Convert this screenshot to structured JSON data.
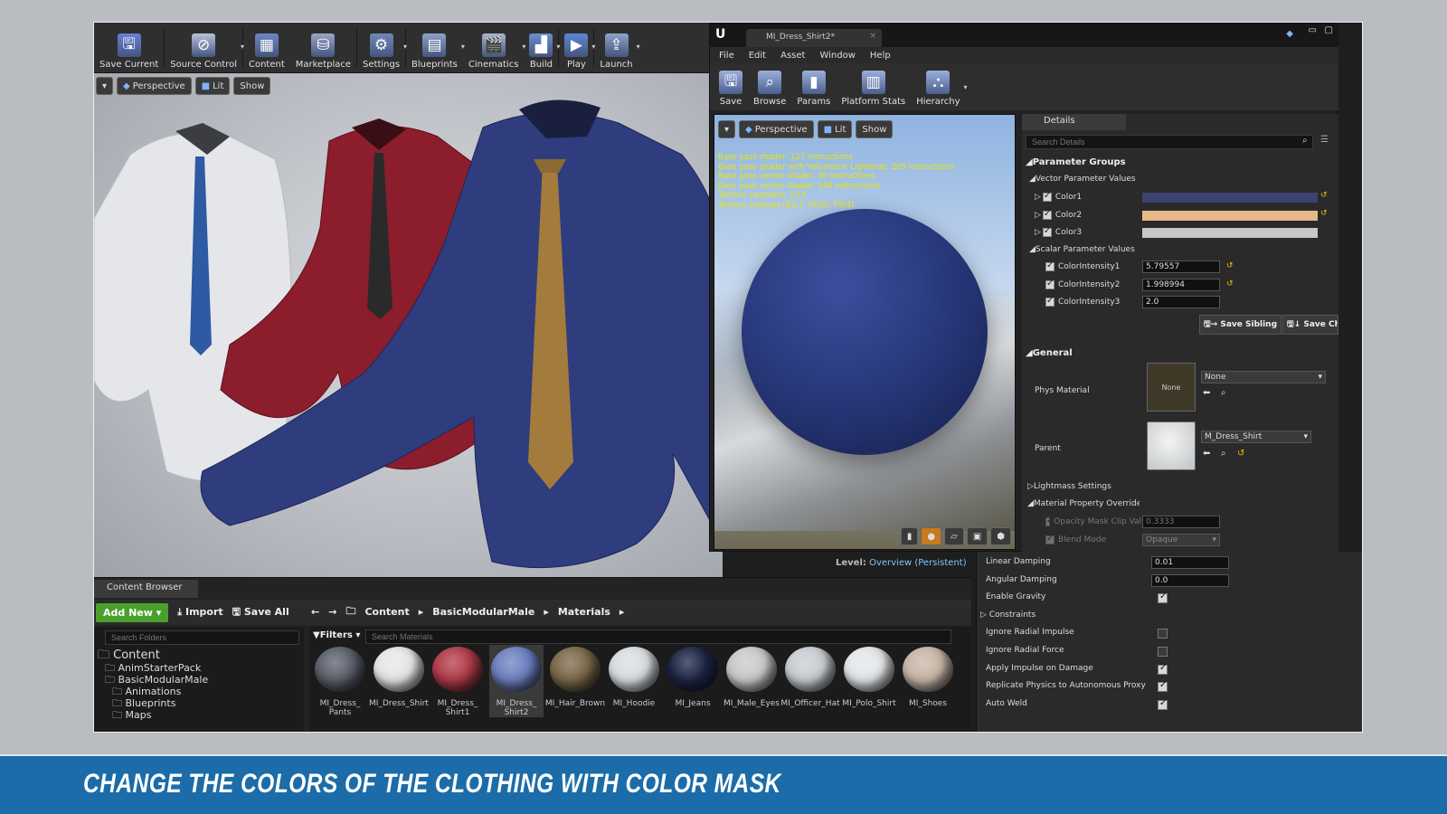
{
  "banner": {
    "text": "CHANGE THE COLORS OF THE CLOTHING WITH COLOR MASK"
  },
  "editor": {
    "toolbar": [
      {
        "label": "Save Current",
        "icon": "save-icon",
        "color": "#6a7fd8"
      },
      {
        "label": "Source Control",
        "icon": "source-control-icon",
        "color": "#b8c2d8"
      },
      {
        "label": "Content",
        "icon": "content-icon",
        "color": "#6f86c4"
      },
      {
        "label": "Marketplace",
        "icon": "marketplace-icon",
        "color": "#9aa6c6"
      },
      {
        "label": "Settings",
        "icon": "gear-icon",
        "color": "#7088b8"
      },
      {
        "label": "Blueprints",
        "icon": "blueprints-icon",
        "color": "#8fa0c8"
      },
      {
        "label": "Cinematics",
        "icon": "cinematics-icon",
        "color": "#a8b4cc"
      },
      {
        "label": "Build",
        "icon": "build-icon",
        "color": "#6a8fd0"
      },
      {
        "label": "Play",
        "icon": "play-icon",
        "color": "#5d86d6"
      },
      {
        "label": "Launch",
        "icon": "launch-icon",
        "color": "#8da2c8"
      }
    ],
    "viewport": {
      "perspective": "Perspective",
      "lit": "Lit",
      "show": "Show"
    },
    "level": {
      "label": "Level:",
      "value": "Overview (Persistent)"
    }
  },
  "content_browser": {
    "tab": "Content Browser",
    "add_new": "Add New",
    "import": "Import",
    "save_all": "Save All",
    "breadcrumbs": [
      "Content",
      "BasicModularMale",
      "Materials"
    ],
    "search_folders_placeholder": "Search Folders",
    "filters": "Filters",
    "search_materials_placeholder": "Search Materials",
    "tree": [
      {
        "label": "Content",
        "level": 0
      },
      {
        "label": "AnimStarterPack",
        "level": 1
      },
      {
        "label": "BasicModularMale",
        "level": 1
      },
      {
        "label": "Animations",
        "level": 2
      },
      {
        "label": "Blueprints",
        "level": 2
      },
      {
        "label": "Maps",
        "level": 2
      }
    ],
    "assets": [
      {
        "label": "MI_Dress_ Pants",
        "color": "#5a5f6a"
      },
      {
        "label": "MI_Dress_Shirt",
        "color": "#e6e6e6"
      },
      {
        "label": "MI_Dress_ Shirt1",
        "color": "#b03a48"
      },
      {
        "label": "MI_Dress_ Shirt2",
        "color": "#6a7fbf"
      },
      {
        "label": "MI_Hair_Brown",
        "color": "#7a6848"
      },
      {
        "label": "MI_Hoodie",
        "color": "#d8dde0"
      },
      {
        "label": "MI_Jeans",
        "color": "#1c2445"
      },
      {
        "label": "MI_Male_Eyes",
        "color": "#c9c9c9"
      },
      {
        "label": "MI_Officer_Hat",
        "color": "#c8cdd2"
      },
      {
        "label": "MI_Polo_Shirt",
        "color": "#e3e6e8"
      },
      {
        "label": "MI_Shoes",
        "color": "#c8b6a6"
      }
    ]
  },
  "material_editor": {
    "tab": "MI_Dress_Shirt2*",
    "menu": [
      "File",
      "Edit",
      "Asset",
      "Window",
      "Help"
    ],
    "toolbar": [
      {
        "label": "Save",
        "icon": "save-icon"
      },
      {
        "label": "Browse",
        "icon": "browse-icon"
      },
      {
        "label": "Params",
        "icon": "params-icon"
      },
      {
        "label": "Platform Stats",
        "icon": "platform-stats-icon"
      },
      {
        "label": "Hierarchy",
        "icon": "hierarchy-icon"
      }
    ],
    "viewport": {
      "perspective": "Perspective",
      "lit": "Lit",
      "show": "Show"
    },
    "stats": [
      "Base pass shader: 127 instructions",
      "Base pass shader with Volumetric Lightmap: 205 instructions",
      "Base pass vertex shader: 36 instructions",
      "Base pass vertex shader: 148 instructions",
      "Texture samplers: 7/16",
      "Texture Lookups (Est.): VS(0), PS(4)"
    ]
  },
  "details": {
    "tab": "Details",
    "search_placeholder": "Search Details",
    "parameter_groups": "Parameter Groups",
    "vector_header": "Vector Parameter Values",
    "vectors": [
      {
        "name": "Color1",
        "color": "#3b4370"
      },
      {
        "name": "Color2",
        "color": "#e7b888"
      },
      {
        "name": "Color3",
        "color": "#c7c7c7"
      }
    ],
    "scalar_header": "Scalar Parameter Values",
    "scalars": [
      {
        "name": "ColorIntensity1",
        "value": "5.79557"
      },
      {
        "name": "ColorIntensity2",
        "value": "1.998994"
      },
      {
        "name": "ColorIntensity3",
        "value": "2.0"
      }
    ],
    "save_sibling": "Save Sibling",
    "save_child": "Save Chi",
    "general": "General",
    "phys_material": {
      "label": "Phys Material",
      "thumb": "None",
      "value": "None"
    },
    "parent": {
      "label": "Parent",
      "value": "M_Dress_Shirt"
    },
    "lightmass": "Lightmass Settings",
    "mat_override": "Material Property Override",
    "opacity": {
      "label": "Opacity Mask Clip Val",
      "value": "0.3333"
    },
    "blend": {
      "label": "Blend Mode",
      "value": "Opaque"
    }
  },
  "physics": {
    "rows": [
      {
        "label": "Linear Damping",
        "value": "0.01",
        "kind": "num"
      },
      {
        "label": "Angular Damping",
        "value": "0.0",
        "kind": "num"
      },
      {
        "label": "Enable Gravity",
        "kind": "check",
        "checked": true
      },
      {
        "label": "Constraints",
        "kind": "group"
      },
      {
        "label": "Ignore Radial Impulse",
        "kind": "check",
        "checked": false
      },
      {
        "label": "Ignore Radial Force",
        "kind": "check",
        "checked": false
      },
      {
        "label": "Apply Impulse on Damage",
        "kind": "check",
        "checked": true
      },
      {
        "label": "Replicate Physics to Autonomous Proxy",
        "kind": "check",
        "checked": true
      },
      {
        "label": "Auto Weld",
        "kind": "check",
        "checked": true
      }
    ]
  }
}
